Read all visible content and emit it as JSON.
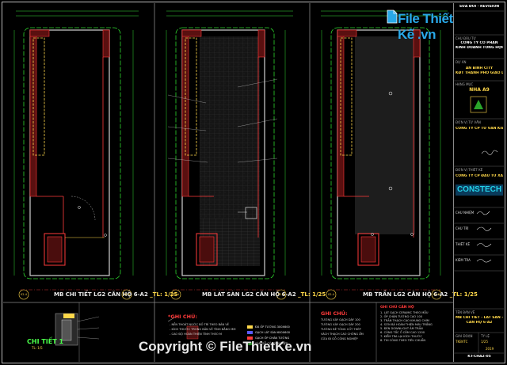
{
  "brand": {
    "name": "File Thiết Kế .vn"
  },
  "revision_header": "SỬA ĐỔI · REVISION",
  "panels": [
    {
      "title": "MB CHI TIẾT LG2 CĂN HỘ 6-A2",
      "scale": "_TL: 1/25"
    },
    {
      "title": "MB LÁT SÀN LG2 CĂN HỘ 6-A2",
      "scale": "_TL: 1/25"
    },
    {
      "title": "MB TRẦN LG2 CĂN HỘ 6-A2",
      "scale": "_TL: 1/25"
    }
  ],
  "grid_labels": {
    "left": "02-4",
    "right": "02-8"
  },
  "detail": {
    "label": "CHI TIẾT 1",
    "scale": "TL: 1/5"
  },
  "notes": {
    "title_mid": "*GHI CHÚ:",
    "title_right": "GHI CHÚ:",
    "title_far": "GHI CHÚ CĂN HỘ",
    "mid_lines": [
      "- NỀN THOÁT NƯỚC BỐ TRÍ THEO BẢN VẼ",
      "- KÍCH THƯỚC TRONG BẢN VẼ TÍNH BẰNG MM",
      "- CAO ĐỘ HOÀN THIỆN TÍNH THEO M"
    ],
    "legend": [
      {
        "label": "ĐÁ ỐP TƯỜNG 300X600",
        "color": "#ffd84a"
      },
      {
        "label": "GẠCH LÁT SÀN 600X600",
        "color": "#5a5aff"
      },
      {
        "label": "GẠCH ỐP CHÂN TƯỜNG",
        "color": "#ff3a3a"
      },
      {
        "label": "SÀN GỖ CÔNG NGHIỆP",
        "color": "#2aa42a"
      }
    ],
    "right_lines": [
      "TƯỜNG XÂY GẠCH DÀY 100",
      "TƯỜNG XÂY GẠCH DÀY 200",
      "TƯỜNG BÊ TÔNG CỐT THÉP",
      "VÁCH THẠCH CAO CHỐNG ẨM",
      "CỬA ĐI GỖ CÔNG NGHIỆP"
    ],
    "far_lines": [
      "1. LÁT GẠCH CERAMIC THEO MẪU",
      "2. ỐP CHÂN TƯỜNG CAO 100",
      "3. TRẦN THẠCH CAO KHUNG CHÌM",
      "4. SƠN BẢ HOÀN THIỆN MÀU TRẮNG",
      "5. ĐÈN DOWNLIGHT ÂM TRẦN",
      "6. CÔNG TẮC Ổ CẮM CAO 1200",
      "7. KIỂM TRA LẠI KÍCH THƯỚC",
      "8. THI CÔNG THEO TIÊU CHUẨN"
    ]
  },
  "title_block": {
    "owner_label": "CHỦ ĐẦU TƯ",
    "owner_name": "CÔNG TY CỔ PHẦN",
    "owner_name2": "KINH DOANH TỔNG HỢP",
    "project_label": "DỰ ÁN",
    "project": "AN BÌNH CITY",
    "project2": "KĐT THÀNH PHỐ GIAO LƯU",
    "item_label": "HẠNG MỤC",
    "item": "NHÀ A9",
    "consult_label": "ĐƠN VỊ TƯ VẤN",
    "consult": "CÔNG TY CP TƯ VẤN KIẾN TRÚC",
    "design_label": "ĐƠN VỊ THIẾT KẾ",
    "design": "CÔNG TY CP ĐẦU TƯ XÂY DỰNG",
    "constech": "CONSTECH",
    "roles": [
      "CHỦ NHIỆM",
      "CHỦ TRÌ",
      "THIẾT KẾ",
      "KIỂM TRA"
    ],
    "drawing_title_label": "TÊN BẢN VẼ",
    "drawing_title": "MB CHI TIẾT - LÁT SÀN - TRẦN LG2",
    "drawing_title2": "CĂN HỘ 6-A2",
    "stage_label": "GIAI ĐOẠN",
    "stage": "TKBVTC",
    "scale_label": "TỶ LỆ",
    "scale": "1/25",
    "sheet_no": "KT-CHA2-05",
    "date": "2019"
  },
  "copyright": "Copyright © FileThietKe.vn"
}
